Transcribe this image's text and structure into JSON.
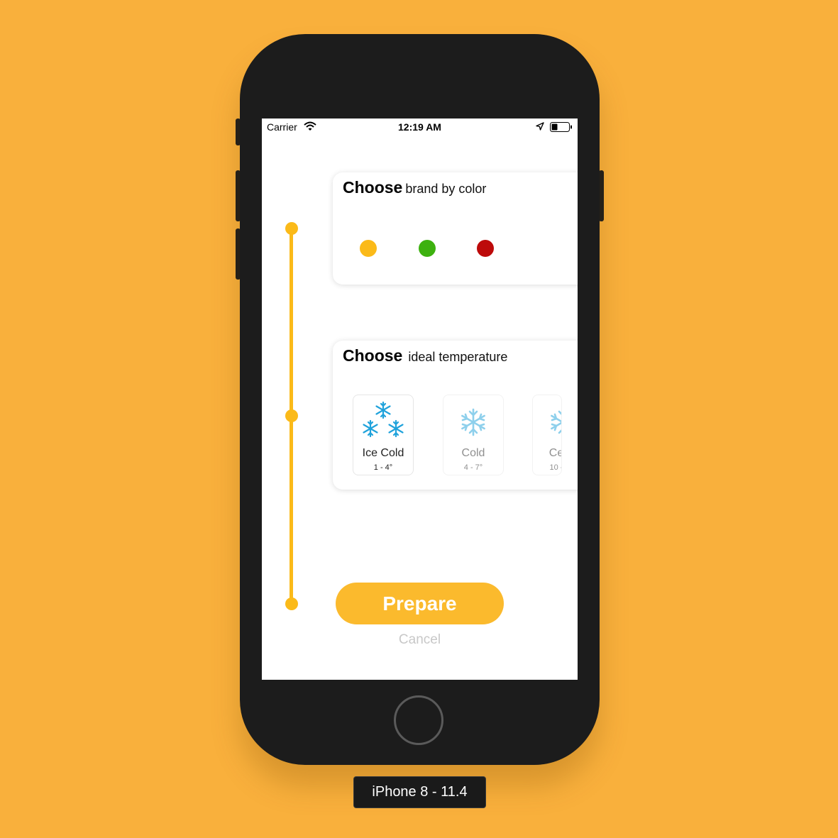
{
  "status_bar": {
    "carrier": "Carrier",
    "time": "12:19 AM"
  },
  "brand_card": {
    "title_strong": "Choose",
    "title_rest": "brand by color",
    "colors": [
      "#FBBA19",
      "#3DB10F",
      "#BD0A0A"
    ]
  },
  "temperature_card": {
    "title_strong": "Choose",
    "title_rest": "ideal temperature",
    "options": [
      {
        "name": "Ice Cold",
        "range": "1 - 4°",
        "icon": "three-snowflakes-icon",
        "selected": true
      },
      {
        "name": "Cold",
        "range": "4 - 7°",
        "icon": "snowflake-icon",
        "selected": false
      },
      {
        "name": "Ce",
        "range": "10 -",
        "icon": "half-snowflake-icon",
        "selected": false
      }
    ]
  },
  "actions": {
    "prepare_label": "Prepare",
    "cancel_label": "Cancel"
  },
  "simulator": {
    "device_label": "iPhone 8 - 11.4"
  },
  "colors": {
    "background": "#F9B03C",
    "accent": "#FBBA19",
    "snowflake": "#1FA2DB"
  }
}
